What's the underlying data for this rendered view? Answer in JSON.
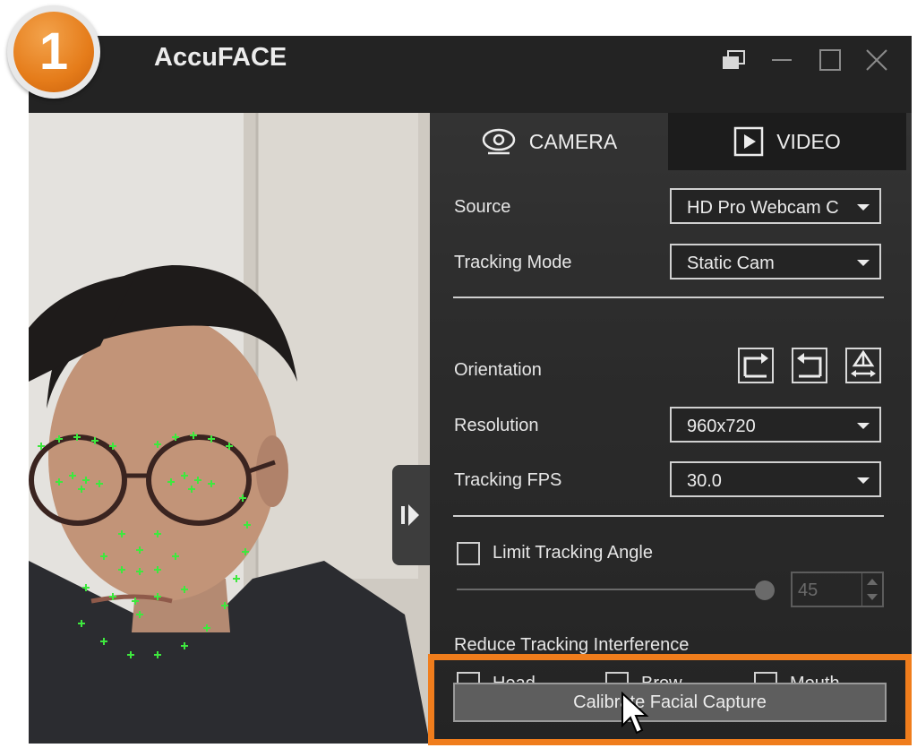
{
  "step_badge": "1",
  "window": {
    "title": "AccuFACE"
  },
  "tabs": [
    {
      "label": "CAMERA",
      "icon": "webcam-icon"
    },
    {
      "label": "VIDEO",
      "icon": "play-icon"
    }
  ],
  "settings": {
    "source": {
      "label": "Source",
      "value": "HD Pro Webcam C"
    },
    "tracking_mode": {
      "label": "Tracking Mode",
      "value": "Static Cam"
    },
    "orientation": {
      "label": "Orientation",
      "icons": [
        "rotate-right-icon",
        "rotate-left-icon",
        "flip-icon"
      ]
    },
    "resolution": {
      "label": "Resolution",
      "value": "960x720"
    },
    "tracking_fps": {
      "label": "Tracking FPS",
      "value": "30.0"
    },
    "limit_tracking_angle": {
      "label": "Limit Tracking Angle",
      "checked": false,
      "value": "45"
    },
    "reduce_interference": {
      "label": "Reduce Tracking Interference",
      "options": [
        {
          "label": "Head",
          "checked": false
        },
        {
          "label": "Brow",
          "checked": false
        },
        {
          "label": "Mouth",
          "checked": false
        }
      ]
    }
  },
  "calibrate_button": "Calibrate Facial Capture",
  "colors": {
    "accent": "#f07d1c",
    "tracking_points": "#3ee83e",
    "window_bg": "#1f1f1f"
  }
}
